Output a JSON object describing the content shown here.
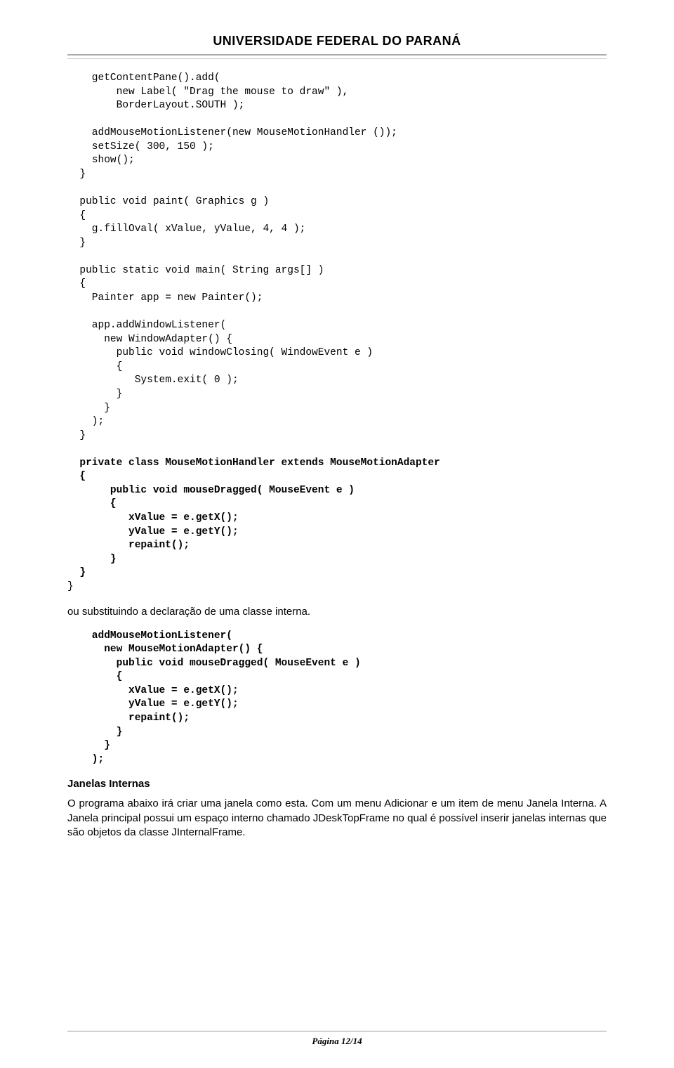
{
  "header": {
    "title": "UNIVERSIDADE FEDERAL DO PARANÁ"
  },
  "code1": {
    "l01": "    getContentPane().add(",
    "l02": "        new Label( \"Drag the mouse to draw\" ),",
    "l03": "        BorderLayout.SOUTH );",
    "l04": "",
    "l05": "    addMouseMotionListener(new MouseMotionHandler ());",
    "l06": "    setSize( 300, 150 );",
    "l07": "    show();",
    "l08": "  }",
    "l09": "",
    "l10": "  public void paint( Graphics g )",
    "l11": "  {",
    "l12": "    g.fillOval( xValue, yValue, 4, 4 );",
    "l13": "  }",
    "l14": "",
    "l15": "  public static void main( String args[] )",
    "l16": "  {",
    "l17": "    Painter app = new Painter();",
    "l18": "",
    "l19": "    app.addWindowListener(",
    "l20": "      new WindowAdapter() {",
    "l21": "        public void windowClosing( WindowEvent e )",
    "l22": "        {",
    "l23": "           System.exit( 0 );",
    "l24": "        }",
    "l25": "      }",
    "l26": "    );",
    "l27": "  }",
    "l28": "",
    "l29": "  private class MouseMotionHandler extends MouseMotionAdapter",
    "l30": "  {",
    "l31": "       public void mouseDragged( MouseEvent e )",
    "l32": "       {",
    "l33": "          xValue = e.getX();",
    "l34": "          yValue = e.getY();",
    "l35": "          repaint();",
    "l36": "       }",
    "l37": "  }",
    "l38": "}"
  },
  "para1": "ou substituindo a declaração de uma classe interna.",
  "code2": {
    "l01": "    addMouseMotionListener(",
    "l02": "      new MouseMotionAdapter() {",
    "l03": "        public void mouseDragged( MouseEvent e )",
    "l04": "        {",
    "l05": "          xValue = e.getX();",
    "l06": "          yValue = e.getY();",
    "l07": "          repaint();",
    "l08": "        }",
    "l09": "      }",
    "l10": "    );"
  },
  "heading2": "Janelas Internas",
  "para2": "O programa abaixo irá criar uma janela como esta. Com um menu Adicionar e um item de menu Janela Interna. A Janela principal possui um espaço interno chamado JDeskTopFrame no qual é possível inserir janelas internas que são objetos da classe JInternalFrame.",
  "footer": "Página 12/14"
}
